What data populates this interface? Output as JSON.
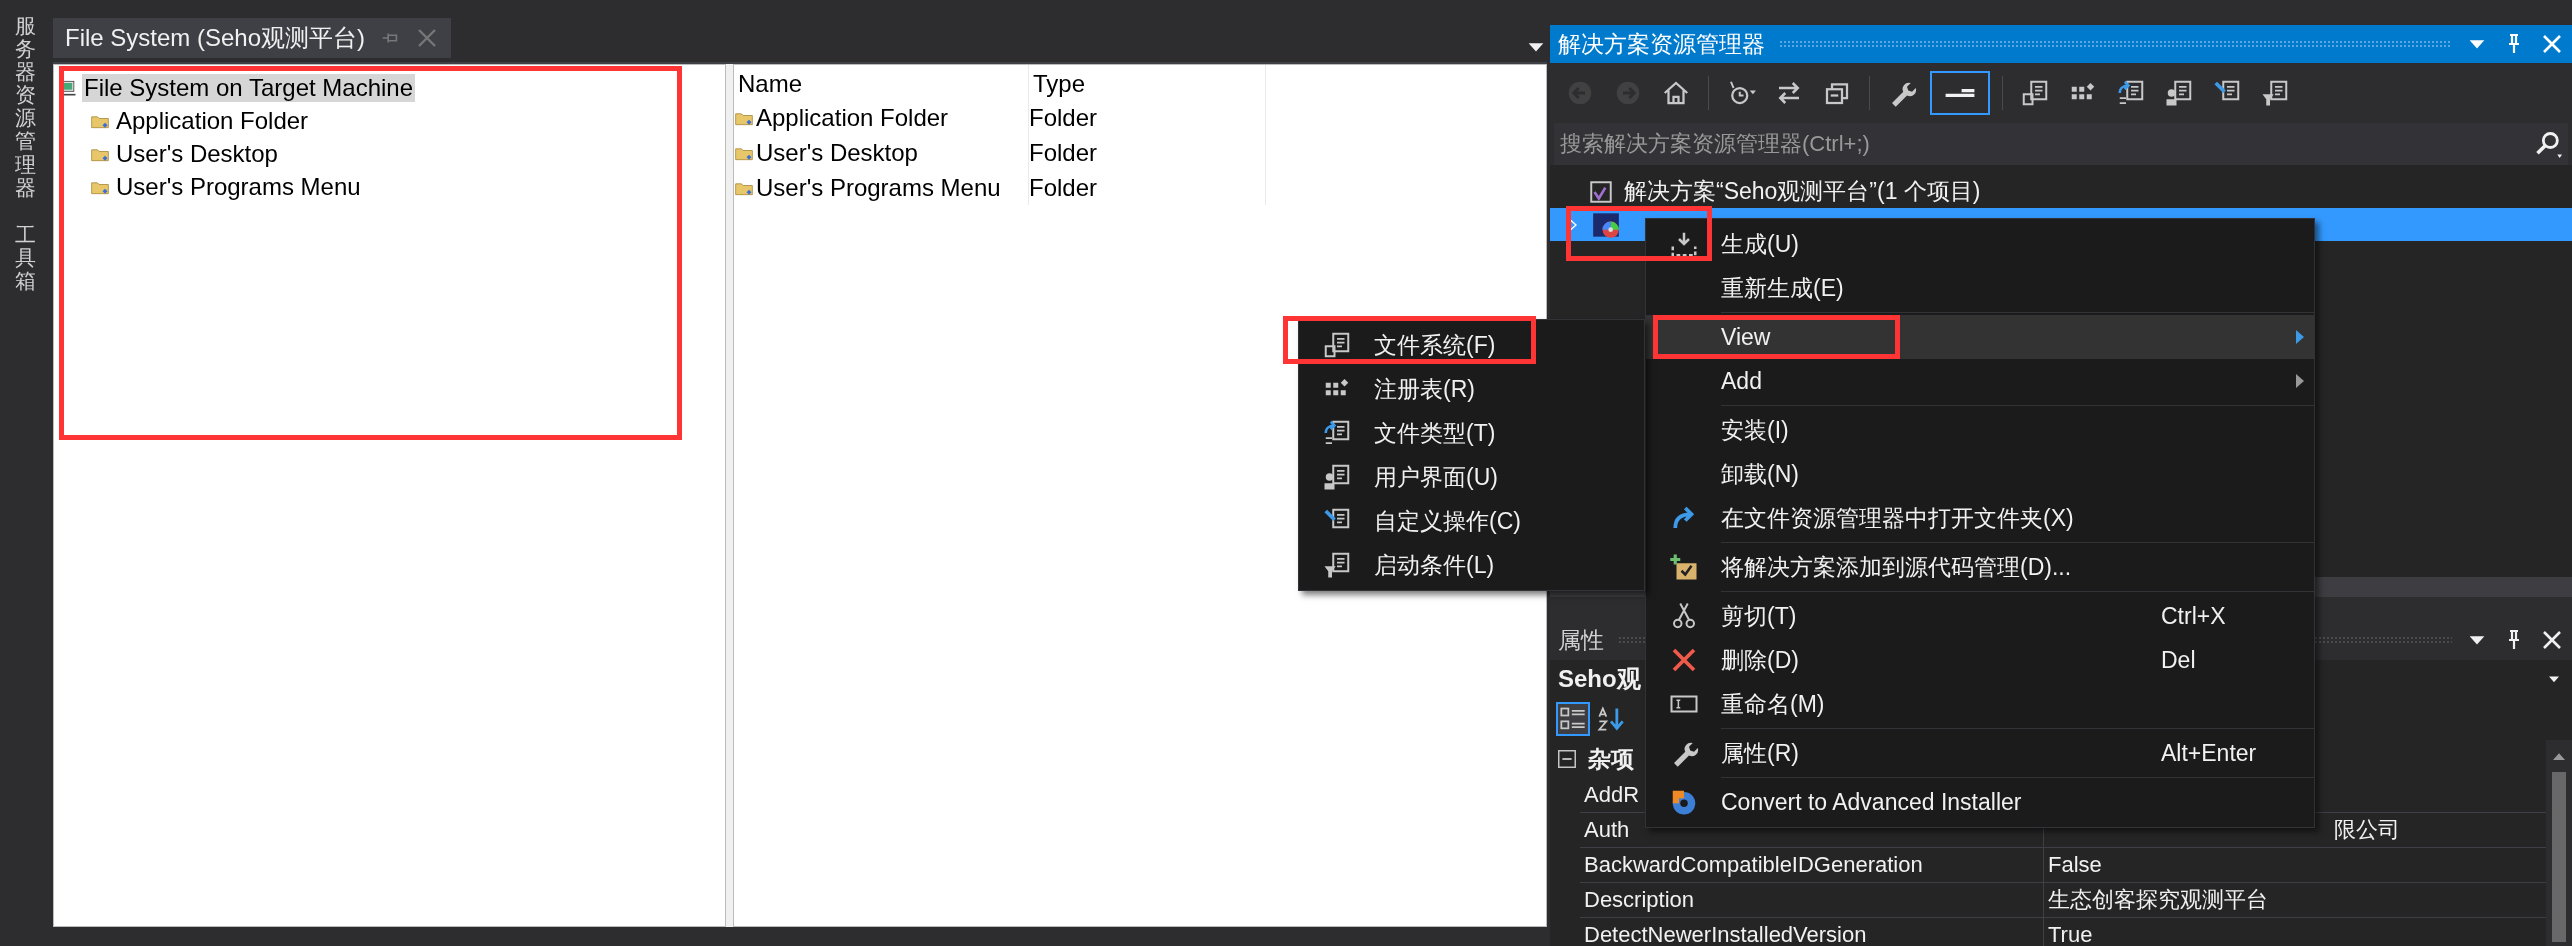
{
  "side_tabs": [
    {
      "label": "服务器资源管理器"
    },
    {
      "label": "工具箱"
    }
  ],
  "document": {
    "tab": {
      "title": "File System (Seho观测平台)",
      "selected": true
    },
    "tree": {
      "annotated": true,
      "root": {
        "label": "File System on Target Machine",
        "selected": true,
        "children": [
          {
            "label": "Application Folder"
          },
          {
            "label": "User's Desktop"
          },
          {
            "label": "User's Programs Menu"
          }
        ]
      }
    },
    "list": {
      "columns": [
        "Name",
        "Type"
      ],
      "rows": [
        {
          "name": "Application Folder",
          "type": "Folder"
        },
        {
          "name": "User's Desktop",
          "type": "Folder"
        },
        {
          "name": "User's Programs Menu",
          "type": "Folder"
        }
      ]
    }
  },
  "solution_explorer": {
    "title": "解决方案资源管理器",
    "toolbar": [
      {
        "kind": "button",
        "disabled": true,
        "selected": false
      },
      {
        "kind": "button",
        "disabled": true,
        "selected": false
      },
      {
        "kind": "button",
        "disabled": false,
        "selected": false
      },
      {
        "kind": "separator"
      },
      {
        "kind": "button",
        "disabled": false,
        "selected": false
      },
      {
        "kind": "button",
        "disabled": false,
        "selected": false
      },
      {
        "kind": "button",
        "disabled": false,
        "selected": false
      },
      {
        "kind": "separator"
      },
      {
        "kind": "button",
        "disabled": false,
        "selected": false
      },
      {
        "kind": "button",
        "disabled": false,
        "selected": true
      },
      {
        "kind": "separator"
      },
      {
        "kind": "button",
        "disabled": false,
        "selected": false
      },
      {
        "kind": "button",
        "disabled": false,
        "selected": false
      },
      {
        "kind": "button",
        "disabled": false,
        "selected": false
      },
      {
        "kind": "button",
        "disabled": false,
        "selected": false
      },
      {
        "kind": "button",
        "disabled": false,
        "selected": false
      },
      {
        "kind": "button",
        "disabled": false,
        "selected": false
      }
    ],
    "search": {
      "placeholder": "搜索解决方案资源管理器(Ctrl+;)"
    },
    "tree": [
      {
        "kind": "solution",
        "label": "解决方案“Seho观测平台”(1 个项目)",
        "selected": false,
        "annotated": false
      },
      {
        "kind": "project",
        "selected": true,
        "expanded": false,
        "annotated": true
      }
    ]
  },
  "properties": {
    "title": "属性",
    "object": "Seho观",
    "view_buttons": [
      {
        "selected": true
      },
      {
        "selected": false
      }
    ],
    "category": {
      "label": "杂项",
      "expanded": true,
      "rows": [
        {
          "name": "AddR"
        },
        {
          "name": "Auth",
          "value": "限公司"
        },
        {
          "name": "BackwardCompatibleIDGeneration",
          "value": "False"
        },
        {
          "name": "Description",
          "value": "生态创客探究观测平台"
        },
        {
          "name": "DetectNewerInstalledVersion",
          "value": "True"
        }
      ]
    }
  },
  "context_menu": {
    "items": [
      {
        "kind": "item",
        "label": "生成(U)",
        "hovered": false
      },
      {
        "kind": "item",
        "label": "重新生成(E)",
        "hovered": false
      },
      {
        "kind": "separator"
      },
      {
        "kind": "submenu",
        "label": "View",
        "hovered": true,
        "annotated": true
      },
      {
        "kind": "submenu",
        "label": "Add",
        "hovered": false,
        "annotated": false
      },
      {
        "kind": "separator"
      },
      {
        "kind": "item",
        "label": "安装(I)",
        "hovered": false
      },
      {
        "kind": "item",
        "label": "卸载(N)",
        "hovered": false
      },
      {
        "kind": "item",
        "label": "在文件资源管理器中打开文件夹(X)",
        "hovered": false
      },
      {
        "kind": "separator"
      },
      {
        "kind": "item",
        "label": "将解决方案添加到源代码管理(D)...",
        "hovered": false
      },
      {
        "kind": "separator"
      },
      {
        "kind": "item",
        "label": "剪切(T)",
        "shortcut": "Ctrl+X",
        "hovered": false
      },
      {
        "kind": "item",
        "label": "删除(D)",
        "shortcut": "Del",
        "hovered": false
      },
      {
        "kind": "item",
        "label": "重命名(M)",
        "hovered": false
      },
      {
        "kind": "separator"
      },
      {
        "kind": "item",
        "label": "属性(R)",
        "shortcut": "Alt+Enter",
        "hovered": false
      },
      {
        "kind": "separator"
      },
      {
        "kind": "item",
        "label": "Convert to Advanced Installer",
        "hovered": false
      }
    ]
  },
  "view_submenu": {
    "items": [
      {
        "label": "文件系统(F)",
        "hovered": false,
        "annotated": true
      },
      {
        "label": "注册表(R)",
        "hovered": false,
        "annotated": false
      },
      {
        "label": "文件类型(T)",
        "hovered": false,
        "annotated": false
      },
      {
        "label": "用户界面(U)",
        "hovered": false,
        "annotated": false
      },
      {
        "label": "自定义操作(C)",
        "hovered": false,
        "annotated": false
      },
      {
        "label": "启动条件(L)",
        "hovered": false,
        "annotated": false
      }
    ]
  }
}
